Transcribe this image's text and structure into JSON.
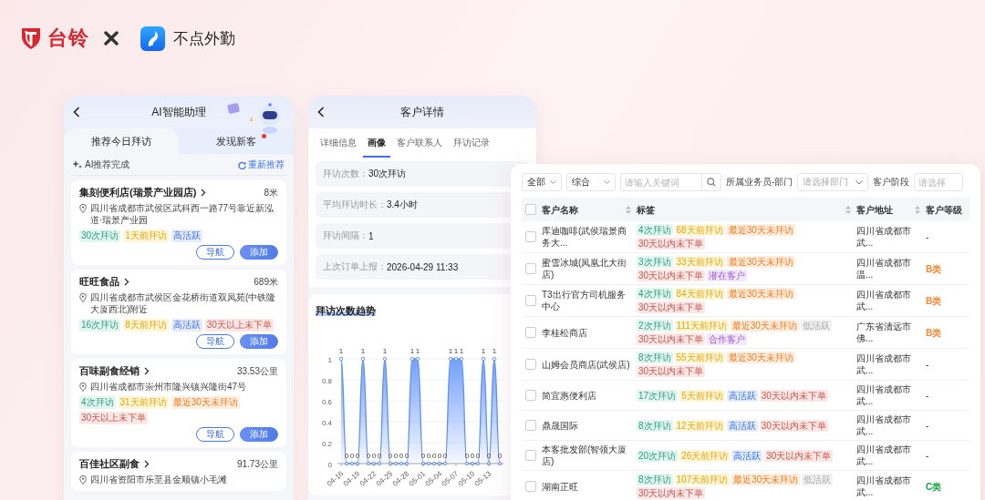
{
  "header": {
    "brand": "台铃",
    "partner": "不点外勤"
  },
  "assistant_screen": {
    "title": "AI智能助理",
    "tabs": [
      {
        "label": "推荐今日拜访",
        "selected": true,
        "dot": false
      },
      {
        "label": "发现新客",
        "selected": false,
        "dot": true
      }
    ],
    "status": "AI推荐完成",
    "refresh": "重新推荐",
    "stores": [
      {
        "name": "集刻便利店(瑞景产业园店)",
        "distance": "8米",
        "address": "四川省成都市武侯区武科西一路77号靠近新泓道·瑞景产业园",
        "tags": [
          {
            "text": "30次拜访",
            "kind": "visits"
          },
          {
            "text": "1天前拜访",
            "kind": "recent"
          },
          {
            "text": "高活跃",
            "kind": "hot"
          }
        ],
        "actions": [
          {
            "label": "导航",
            "kind": "outline"
          },
          {
            "label": "添加",
            "kind": "primary"
          }
        ]
      },
      {
        "name": "旺旺食品",
        "distance": "689米",
        "address": "四川省成都市武侯区金花桥街道双凤苑(中铁隆大厦西北)附近",
        "tags": [
          {
            "text": "16次拜访",
            "kind": "visits"
          },
          {
            "text": "8天前拜访",
            "kind": "recent"
          },
          {
            "text": "高活跃",
            "kind": "hot"
          },
          {
            "text": "30天以上未下单",
            "kind": "noorder"
          }
        ],
        "actions": [
          {
            "label": "导航",
            "kind": "outline"
          },
          {
            "label": "添加",
            "kind": "primary"
          }
        ]
      },
      {
        "name": "百味副食经销",
        "distance": "33.53公里",
        "address": "四川省成都市崇州市隆兴镇兴隆街47号",
        "tags": [
          {
            "text": "4次拜访",
            "kind": "visits"
          },
          {
            "text": "31天前拜访",
            "kind": "recent"
          },
          {
            "text": "最近30天未拜访",
            "kind": "unvisited"
          },
          {
            "text": "30天以上未下单",
            "kind": "noorder"
          }
        ],
        "actions": [
          {
            "label": "导航",
            "kind": "outline"
          },
          {
            "label": "添加",
            "kind": "primary"
          }
        ]
      },
      {
        "name": "百佳社区副食",
        "distance": "91.73公里",
        "address": "四川省资阳市乐至县金顺镇小毛滩"
      }
    ]
  },
  "detail_screen": {
    "title": "客户详情",
    "tabs": [
      {
        "label": "详细信息",
        "selected": false
      },
      {
        "label": "画像",
        "selected": true
      },
      {
        "label": "客户联系人",
        "selected": false
      },
      {
        "label": "拜访记录",
        "selected": false
      }
    ],
    "fields": [
      {
        "label": "拜访次数：",
        "value": "30次拜访"
      },
      {
        "label": "平均拜访时长：",
        "value": "3.4小时"
      },
      {
        "label": "拜访间隔：",
        "value": "1"
      },
      {
        "label": "上次订单上报：",
        "value": "2026-04-29 11:33"
      }
    ],
    "chart_title": "拜访次数趋势",
    "chart_data": {
      "type": "area",
      "categories": [
        "04-16",
        null,
        null,
        "04-19",
        null,
        null,
        "04-22",
        null,
        null,
        "04-25",
        null,
        null,
        "04-28",
        null,
        null,
        "05-01",
        null,
        null,
        "05-04",
        null,
        null,
        "05-07",
        null,
        null,
        "05-10",
        null,
        null,
        "05-13",
        null,
        null
      ],
      "grid": true,
      "series": [
        {
          "color": "#5b8ff9",
          "values": [
            1,
            0,
            0,
            0,
            1,
            0,
            0,
            0,
            1,
            0,
            0,
            0,
            0,
            1,
            1,
            0,
            0,
            0,
            0,
            0,
            1,
            1,
            1,
            0,
            0,
            0,
            1,
            0,
            1,
            0
          ]
        }
      ],
      "ylim": [
        0,
        1
      ],
      "yticks": [
        0,
        0.2,
        0.4,
        0.6,
        0.8,
        1
      ],
      "data_labels": true
    }
  },
  "customer_table": {
    "filters": {
      "scope": "全部",
      "sort": "综合",
      "search": {
        "placeholder": "请输入关键词"
      },
      "owner_label": "所属业务员-部门",
      "owner": {
        "placeholder": "请选择部门"
      },
      "stage_label": "客户阶段",
      "stage": {
        "placeholder": "请选择"
      }
    },
    "header_checked": false,
    "columns": [
      {
        "label": "客户名称"
      },
      {
        "label": "标签"
      },
      {
        "label": "客户地址"
      },
      {
        "label": "客户等级"
      }
    ],
    "rows": [
      {
        "checked": false,
        "name": "库迪咖啡(武侯瑞景商务大...",
        "tags": [
          {
            "text": "4次拜访",
            "kind": "visits"
          },
          {
            "text": "68天前拜访",
            "kind": "recent"
          },
          {
            "text": "最近30天未拜访",
            "kind": "unvisited"
          },
          {
            "text": "30天以内未下单",
            "kind": "noorder"
          }
        ],
        "address": "四川省成都市武...",
        "level": "-"
      },
      {
        "checked": false,
        "name": "蜜雪冰城(凤凰北大街店)",
        "tags": [
          {
            "text": "3次拜访",
            "kind": "visits"
          },
          {
            "text": "33天前拜访",
            "kind": "recent"
          },
          {
            "text": "最近30天未拜访",
            "kind": "unvisited"
          },
          {
            "text": "30天以内未下单",
            "kind": "noorder"
          },
          {
            "text": "潜在客户",
            "kind": "stage"
          }
        ],
        "address": "四川省成都市温...",
        "level": "B类",
        "color": "#f08a3c"
      },
      {
        "checked": false,
        "name": "T3出行官方司机服务中心",
        "tags": [
          {
            "text": "4次拜访",
            "kind": "visits"
          },
          {
            "text": "84天前拜访",
            "kind": "recent"
          },
          {
            "text": "最近30天未拜访",
            "kind": "unvisited"
          },
          {
            "text": "30天以内未下单",
            "kind": "noorder"
          }
        ],
        "address": "四川省成都市武...",
        "level": "B类",
        "color": "#f08a3c"
      },
      {
        "checked": false,
        "name": "李桂松商店",
        "tags": [
          {
            "text": "2次拜访",
            "kind": "visits"
          },
          {
            "text": "111天前拜访",
            "kind": "recent"
          },
          {
            "text": "最近30天未拜访",
            "kind": "unvisited"
          },
          {
            "text": "低活跃",
            "kind": "cold"
          },
          {
            "text": "30天以内未下单",
            "kind": "noorder"
          },
          {
            "text": "合作客户",
            "kind": "stage"
          }
        ],
        "address": "广东省清远市佛...",
        "level": "B类",
        "color": "#f08a3c"
      },
      {
        "checked": false,
        "name": "山姆会员商店(武侯店)",
        "tags": [
          {
            "text": "8次拜访",
            "kind": "visits"
          },
          {
            "text": "55天前拜访",
            "kind": "recent"
          },
          {
            "text": "最近30天未拜访",
            "kind": "unvisited"
          },
          {
            "text": "30天以内未下单",
            "kind": "noorder"
          }
        ],
        "address": "四川省成都市武...",
        "level": "-"
      },
      {
        "checked": false,
        "name": "简宜惠便利店",
        "tags": [
          {
            "text": "17次拜访",
            "kind": "visits"
          },
          {
            "text": "5天前拜访",
            "kind": "recent"
          },
          {
            "text": "高活跃",
            "kind": "hot"
          },
          {
            "text": "30天以内未下单",
            "kind": "noorder"
          }
        ],
        "address": "四川省成都市武...",
        "level": "-"
      },
      {
        "checked": false,
        "name": "鼎晟国际",
        "tags": [
          {
            "text": "8次拜访",
            "kind": "visits"
          },
          {
            "text": "12天前拜访",
            "kind": "recent"
          },
          {
            "text": "高活跃",
            "kind": "hot"
          },
          {
            "text": "30天以内未下单",
            "kind": "noorder"
          }
        ],
        "address": "四川省成都市武...",
        "level": "-"
      },
      {
        "checked": false,
        "name": "本客批发部(智领大厦店)",
        "tags": [
          {
            "text": "20次拜访",
            "kind": "visits"
          },
          {
            "text": "26天前拜访",
            "kind": "recent"
          },
          {
            "text": "高活跃",
            "kind": "hot"
          },
          {
            "text": "30天以内未下单",
            "kind": "noorder"
          }
        ],
        "address": "四川省成都市武...",
        "level": "-"
      },
      {
        "checked": false,
        "name": "湖南正旺",
        "tags": [
          {
            "text": "8次拜访",
            "kind": "visits"
          },
          {
            "text": "107天前拜访",
            "kind": "recent"
          },
          {
            "text": "最近30天未拜访",
            "kind": "unvisited"
          },
          {
            "text": "低活跃",
            "kind": "cold"
          },
          {
            "text": "30天以内未下单",
            "kind": "noorder"
          }
        ],
        "address": "四川省成都市武...",
        "level": "C类",
        "color": "#1aa33c"
      }
    ]
  }
}
